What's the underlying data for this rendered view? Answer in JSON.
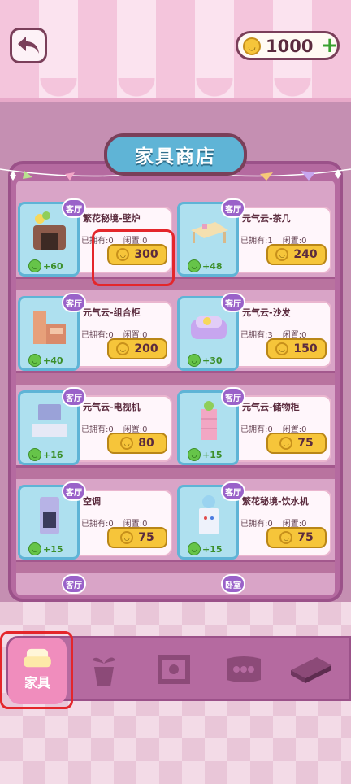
{
  "header": {
    "back_icon": "back-arrow-icon",
    "coins": "1000",
    "coin_icon": "smiley-coin-icon",
    "plus_icon": "plus-icon"
  },
  "shop": {
    "title": "家具商店"
  },
  "items": [
    {
      "name": "繁花秘境-壁炉",
      "room": "客厅",
      "owned": "已拥有:0",
      "idle": "闲置:0",
      "score": "+60",
      "price": "300",
      "icon": "fireplace-icon"
    },
    {
      "name": "元气云-茶几",
      "room": "客厅",
      "owned": "已拥有:1",
      "idle": "闲置:0",
      "score": "+48",
      "price": "240",
      "icon": "coffee-table-icon"
    },
    {
      "name": "元气云-组合柜",
      "room": "客厅",
      "owned": "已拥有:0",
      "idle": "闲置:0",
      "score": "+40",
      "price": "200",
      "icon": "cabinet-icon"
    },
    {
      "name": "元气云-沙发",
      "room": "客厅",
      "owned": "已拥有:3",
      "idle": "闲置:0",
      "score": "+30",
      "price": "150",
      "icon": "sofa-icon"
    },
    {
      "name": "元气云-电视机",
      "room": "客厅",
      "owned": "已拥有:0",
      "idle": "闲置:0",
      "score": "+16",
      "price": "80",
      "icon": "tv-icon"
    },
    {
      "name": "元气云-储物柜",
      "room": "客厅",
      "owned": "已拥有:0",
      "idle": "闲置:0",
      "score": "+15",
      "price": "75",
      "icon": "storage-shelf-icon"
    },
    {
      "name": "空调",
      "room": "客厅",
      "owned": "已拥有:0",
      "idle": "闲置:0",
      "score": "+15",
      "price": "75",
      "icon": "air-conditioner-icon"
    },
    {
      "name": "繁花秘境-饮水机",
      "room": "客厅",
      "owned": "已拥有:0",
      "idle": "闲置:0",
      "score": "+15",
      "price": "75",
      "icon": "water-dispenser-icon"
    }
  ],
  "peek_badges": [
    "客厅",
    "卧室"
  ],
  "nav": [
    {
      "label": "家具",
      "icon": "armchair-icon",
      "active": true
    },
    {
      "label": "",
      "icon": "plant-pot-icon",
      "active": false
    },
    {
      "label": "",
      "icon": "framed-picture-icon",
      "active": false
    },
    {
      "label": "",
      "icon": "rug-icon",
      "active": false
    },
    {
      "label": "",
      "icon": "floor-tile-icon",
      "active": false
    }
  ]
}
